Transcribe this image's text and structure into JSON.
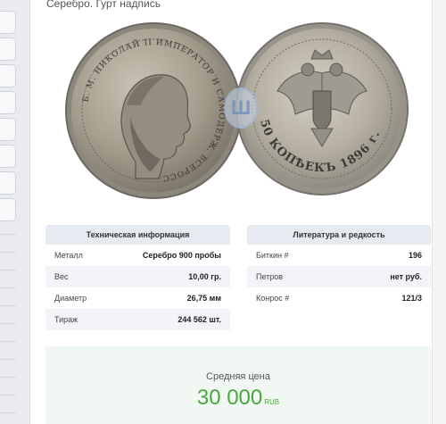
{
  "caption": "Серебро. Гурт надпись",
  "tech": {
    "heading": "Техническая информация",
    "rows": [
      {
        "label": "Металл",
        "value": "Серебро 900 пробы"
      },
      {
        "label": "Вес",
        "value": "10,00 гр."
      },
      {
        "label": "Диаметр",
        "value": "26,75 мм"
      },
      {
        "label": "Тираж",
        "value": "244 562 шт."
      }
    ]
  },
  "literature": {
    "heading": "Литература и редкость",
    "rows": [
      {
        "label": "Биткин #",
        "value": "196"
      },
      {
        "label": "Петров",
        "value": "нет руб."
      },
      {
        "label": "Конрос #",
        "value": "121/3"
      }
    ]
  },
  "price": {
    "label": "Средняя цена",
    "value": "30 000",
    "currency": "RUB",
    "color": "#4aa73c"
  },
  "coin": {
    "obverse_legend": "Б. М. НИКОЛАЙ II ИМПЕРАТОР И САМОДЕРЖ. ВСЕРОСС.",
    "reverse_legend": "50 КОПѢЕКЪ 1896 г.",
    "watermark": "Ш"
  }
}
